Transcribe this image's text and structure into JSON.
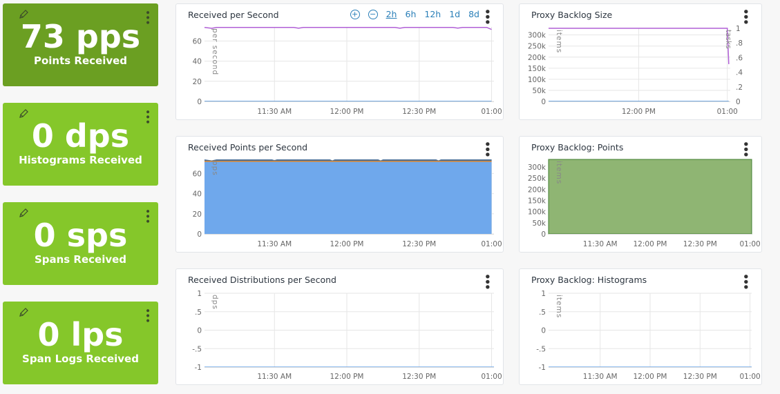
{
  "tiles": [
    {
      "value": "73 pps",
      "label": "Points Received",
      "color": "#6b9f22"
    },
    {
      "value": "0 dps",
      "label": "Histograms Received",
      "color": "#85c72a"
    },
    {
      "value": "0 sps",
      "label": "Spans Received",
      "color": "#85c72a"
    },
    {
      "value": "0 lps",
      "label": "Span Logs Received",
      "color": "#85c72a"
    }
  ],
  "time_controls": {
    "zoom_in": "+",
    "zoom_out": "−",
    "ranges": [
      "2h",
      "6h",
      "12h",
      "1d",
      "8d"
    ],
    "selected": "2h"
  },
  "panels": [
    {
      "title": "Received per Second",
      "ylabel": "per second",
      "xlim": [
        "11:01",
        "13:01"
      ],
      "xticks": [
        [
          "11:30",
          "11:30 AM"
        ],
        [
          "12:00",
          "12:00 PM"
        ],
        [
          "12:30",
          "12:30 PM"
        ],
        [
          "13:00",
          "01:00"
        ]
      ],
      "ylim": [
        0,
        74
      ],
      "yticks": [
        [
          0,
          "0"
        ],
        [
          20,
          "20"
        ],
        [
          40,
          "40"
        ],
        [
          60,
          "60"
        ]
      ],
      "series": [
        {
          "type": "line",
          "color": "#b05fd6",
          "points": [
            [
              "11:01",
              73.5
            ],
            [
              "11:04",
              72.6
            ],
            [
              "11:06",
              73.5
            ],
            [
              "11:38",
              73.5
            ],
            [
              "11:40",
              72.7
            ],
            [
              "11:42",
              73.5
            ],
            [
              "12:20",
              73.5
            ],
            [
              "12:22",
              72.7
            ],
            [
              "12:24",
              73.5
            ],
            [
              "12:44",
              73.5
            ],
            [
              "12:46",
              72.8
            ],
            [
              "12:48",
              73.5
            ],
            [
              "12:58",
              73.5
            ],
            [
              "13:00",
              71.5
            ]
          ]
        },
        {
          "type": "line",
          "color": "#4a8fdc",
          "points": [
            [
              "11:01",
              0
            ],
            [
              "13:00",
              0
            ]
          ]
        }
      ]
    },
    {
      "title": "Proxy Backlog Size",
      "ylabel": "items",
      "y2label": "tasks",
      "xlim": [
        "10:59",
        "13:02"
      ],
      "xticks": [
        [
          "12:00",
          "12:00 PM"
        ],
        [
          "13:00",
          "01:00"
        ]
      ],
      "ylim": [
        0,
        330000
      ],
      "yticks": [
        [
          0,
          "0"
        ],
        [
          50000,
          "50k"
        ],
        [
          100000,
          "100k"
        ],
        [
          150000,
          "150k"
        ],
        [
          200000,
          "200k"
        ],
        [
          250000,
          "250k"
        ],
        [
          300000,
          "300k"
        ]
      ],
      "y2lim": [
        0,
        1
      ],
      "y2ticks": [
        [
          0,
          "0"
        ],
        [
          0.2,
          ".2"
        ],
        [
          0.4,
          ".4"
        ],
        [
          0.6,
          ".6"
        ],
        [
          0.8,
          ".8"
        ],
        [
          1,
          "1"
        ]
      ],
      "series": [
        {
          "type": "line",
          "axis": "y2",
          "color": "#b05fd6",
          "points": [
            [
              "10:59",
              1
            ],
            [
              "13:00",
              1
            ],
            [
              "13:01",
              0.51
            ]
          ]
        },
        {
          "type": "line",
          "color": "#4a8fdc",
          "points": [
            [
              "10:59",
              0
            ],
            [
              "13:01",
              0
            ]
          ]
        }
      ]
    },
    {
      "title": "Received Points per Second",
      "ylabel": "pps",
      "xlim": [
        "11:01",
        "13:01"
      ],
      "xticks": [
        [
          "11:30",
          "11:30 AM"
        ],
        [
          "12:00",
          "12:00 PM"
        ],
        [
          "12:30",
          "12:30 PM"
        ],
        [
          "13:00",
          "01:00"
        ]
      ],
      "ylim": [
        0,
        74
      ],
      "yticks": [
        [
          0,
          "0"
        ],
        [
          20,
          "20"
        ],
        [
          40,
          "40"
        ],
        [
          60,
          "60"
        ]
      ],
      "series": [
        {
          "type": "area",
          "color": "#4d6f94",
          "points": [
            [
              "11:01",
              74
            ],
            [
              "11:04",
              73
            ],
            [
              "11:06",
              74
            ],
            [
              "11:29",
              74
            ],
            [
              "11:30",
              73.2
            ],
            [
              "11:31",
              74
            ],
            [
              "11:53",
              74
            ],
            [
              "11:54",
              73
            ],
            [
              "11:55",
              74
            ],
            [
              "12:13",
              74
            ],
            [
              "12:14",
              73
            ],
            [
              "12:15",
              74
            ],
            [
              "12:37",
              74
            ],
            [
              "12:38",
              73
            ],
            [
              "12:39",
              74
            ],
            [
              "13:00",
              74
            ]
          ]
        },
        {
          "type": "area",
          "color": "#6fa8ec",
          "points": [
            [
              "11:01",
              71.8
            ],
            [
              "13:00",
              71.8
            ]
          ]
        },
        {
          "type": "line",
          "color": "#e0892f",
          "points": [
            [
              "11:01",
              72
            ],
            [
              "13:00",
              72
            ]
          ]
        }
      ]
    },
    {
      "title": "Proxy Backlog: Points",
      "ylabel": "items",
      "xlim": [
        "10:59",
        "13:01"
      ],
      "xticks": [
        [
          "11:30",
          "11:30 AM"
        ],
        [
          "12:00",
          "12:00 PM"
        ],
        [
          "12:30",
          "12:30 PM"
        ],
        [
          "13:00",
          "01:00"
        ]
      ],
      "ylim": [
        0,
        334000
      ],
      "yticks": [
        [
          0,
          "0"
        ],
        [
          50000,
          "50k"
        ],
        [
          100000,
          "100k"
        ],
        [
          150000,
          "150k"
        ],
        [
          200000,
          "200k"
        ],
        [
          250000,
          "250k"
        ],
        [
          300000,
          "300k"
        ]
      ],
      "series": [
        {
          "type": "area",
          "color": "#8fb573",
          "stroke": "#3f7d2f",
          "points": [
            [
              "10:59",
              334000
            ],
            [
              "13:01",
              334000
            ]
          ]
        }
      ]
    },
    {
      "title": "Received Distributions per Second",
      "ylabel": "dps",
      "xlim": [
        "11:01",
        "13:01"
      ],
      "xticks": [
        [
          "11:30",
          "11:30 AM"
        ],
        [
          "12:00",
          "12:00 PM"
        ],
        [
          "12:30",
          "12:30 PM"
        ],
        [
          "13:00",
          "01:00"
        ]
      ],
      "ylim": [
        -1,
        1
      ],
      "yticks": [
        [
          -1,
          "-1"
        ],
        [
          -0.5,
          "-.5"
        ],
        [
          0,
          "0"
        ],
        [
          0.5,
          ".5"
        ],
        [
          1,
          "1"
        ]
      ],
      "series": [
        {
          "type": "line",
          "color": "#6fa8ec",
          "points": [
            [
              "11:01",
              -1
            ],
            [
              "13:01",
              -1
            ]
          ]
        }
      ]
    },
    {
      "title": "Proxy Backlog: Histograms",
      "ylabel": "items",
      "xlim": [
        "10:59",
        "13:01"
      ],
      "xticks": [
        [
          "11:30",
          "11:30 AM"
        ],
        [
          "12:00",
          "12:00 PM"
        ],
        [
          "12:30",
          "12:30 PM"
        ],
        [
          "13:00",
          "01:00"
        ]
      ],
      "ylim": [
        -1,
        1
      ],
      "yticks": [
        [
          -1,
          "-1"
        ],
        [
          -0.5,
          "-.5"
        ],
        [
          0,
          "0"
        ],
        [
          0.5,
          ".5"
        ],
        [
          1,
          "1"
        ]
      ],
      "series": [
        {
          "type": "line",
          "color": "#6fa8ec",
          "points": [
            [
              "10:59",
              -1
            ],
            [
              "13:01",
              -1
            ]
          ]
        }
      ]
    }
  ]
}
